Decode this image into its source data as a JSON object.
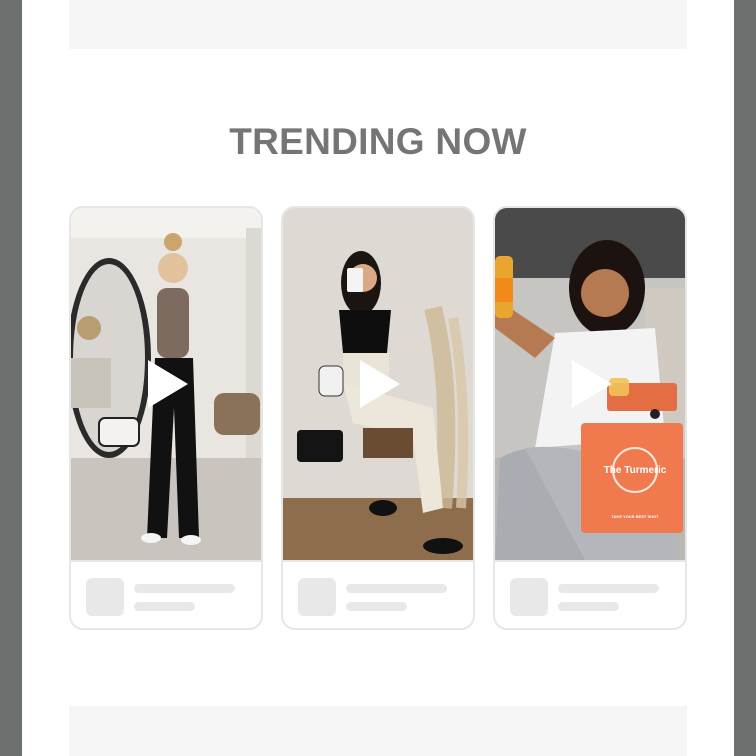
{
  "section": {
    "title": "TRENDING NOW"
  },
  "videos": [
    {
      "label": "video-1",
      "icon": "play-icon"
    },
    {
      "label": "video-2",
      "icon": "play-icon"
    },
    {
      "label": "video-3",
      "icon": "play-icon",
      "product_box_brand": "The Turmeric",
      "product_box_tagline": "TAKE YOUR BEST SHOT"
    }
  ],
  "colors": {
    "frame": "#6b6f6d",
    "title": "#757575",
    "card_border": "#e6e6e6",
    "skeleton": "#e8e8e8",
    "product_box": "#f07a4e"
  }
}
